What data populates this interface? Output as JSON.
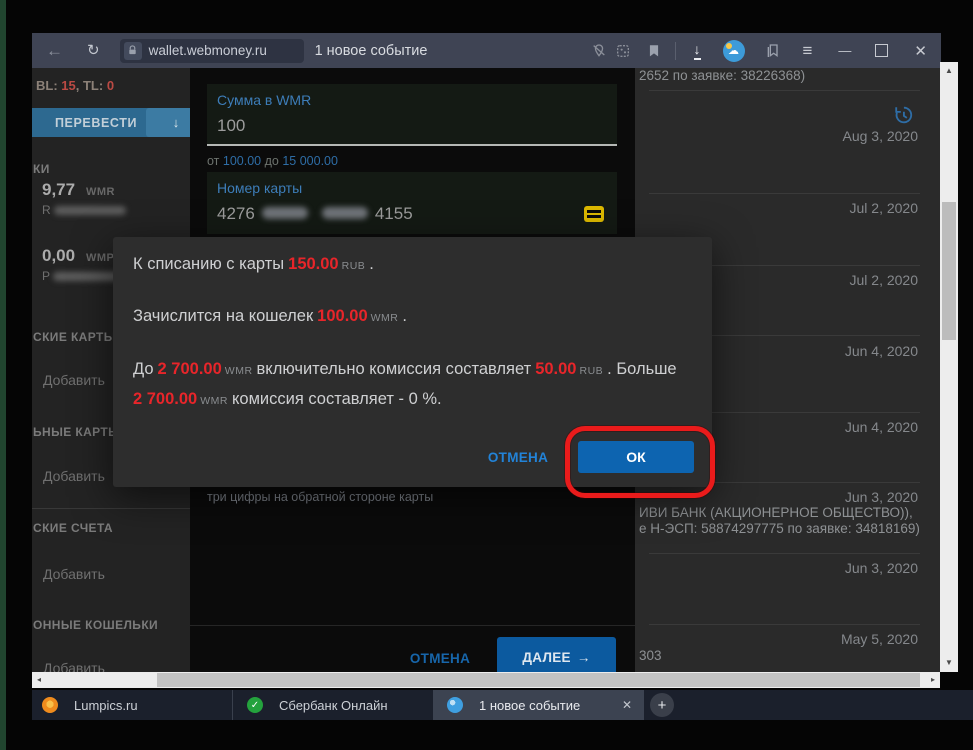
{
  "browser": {
    "url": "wallet.webmoney.ru",
    "page_title": "1 новое событие"
  },
  "glyphs": {
    "back": "←",
    "refresh": "↻",
    "menu": "≡",
    "minimize": "—",
    "close": "✕",
    "download": "↓",
    "cloud": "☁",
    "plus": "+",
    "tab_close": "✕",
    "check": "✓",
    "up": "▲",
    "down": "▼",
    "left": "◂",
    "right": "▸",
    "arrow_down": "↓",
    "arrow_right": "→"
  },
  "sidebar": {
    "bl_label": "BL:",
    "bl_value": "15",
    "tl_label": ", TL:",
    "tl_value": "0",
    "transfer_label": "ПЕРЕВЕСТИ",
    "wallets_header": "КИ",
    "purses": [
      {
        "amount": "9,77",
        "currency": "WMR",
        "mask_letter": "R"
      },
      {
        "amount": "0,00",
        "currency": "WMP",
        "mask_letter": "P"
      }
    ],
    "sections": [
      {
        "title": "СКИЕ КАРТЫ",
        "action": "Добавить"
      },
      {
        "title": "ЬНЫЕ КАРТЫ",
        "action": "Добавить"
      },
      {
        "title": "СКИЕ СЧЕТА",
        "action": "Добавить"
      },
      {
        "title": "ОННЫЕ КОШЕЛЬКИ",
        "action": "Добавить"
      }
    ]
  },
  "form": {
    "amount_label": "Сумма в WMR",
    "amount_value": "100",
    "range_from_label": "от",
    "range_from_value": "100.00",
    "range_to_label": "до",
    "range_to_value": "15 000.00",
    "card_label": "Номер карты",
    "card_first": "4276",
    "card_last": "4155",
    "cvv_hint": "три цифры на обратной стороне карты",
    "cancel_label": "ОТМЕНА",
    "next_label": "ДАЛЕЕ"
  },
  "modal": {
    "debit_text": "К списанию с карты",
    "debit_amount": "150.00",
    "debit_currency": "RUB",
    "debit_dot": ".",
    "credit_text": "Зачислится на кошелек",
    "credit_amount": "100.00",
    "credit_currency": "WMR",
    "credit_dot": ".",
    "fee_pre": "До",
    "fee_limit": "2 700.00",
    "fee_limit_currency": "WMR",
    "fee_mid": "включительно комиссия составляет",
    "fee_amount": "50.00",
    "fee_currency": "RUB",
    "fee_tail": ". Больше",
    "fee2_amount": "2 700.00",
    "fee2_currency": "WMR",
    "fee2_tail": "комиссия составляет - 0 %.",
    "cancel_label": "ОТМЕНА",
    "ok_label": "ОК"
  },
  "events": {
    "top_partial": "2652 по заявке: 38226368)",
    "items": [
      {
        "date": "Aug 3, 2020"
      },
      {
        "date": "Jul 2, 2020"
      },
      {
        "date": "Jul 2, 2020"
      },
      {
        "date": "Jun 4, 2020"
      },
      {
        "date": "Jun 4, 2020"
      },
      {
        "date": "Jun 3, 2020"
      },
      {
        "date": "Jun 3, 2020"
      },
      {
        "date": "May 5, 2020"
      }
    ],
    "bank_line1": "ИВИ БАНК (АКЦИОНЕРНОЕ ОБЩЕСТВО)),",
    "bank_line2": "е Н-ЭСП: 58874297775 по заявке: 34818169)",
    "bottom_partial": "303"
  },
  "tabbar": {
    "tabs": [
      {
        "label": "Lumpics.ru"
      },
      {
        "label": "Сбербанк Онлайн"
      },
      {
        "label": "1 новое событие"
      }
    ]
  },
  "colors": {
    "accent_blue": "#0d64b0",
    "amount_red": "#e8252a",
    "annotation_red": "#ea1b1b",
    "label_blue": "#3d7db9"
  }
}
